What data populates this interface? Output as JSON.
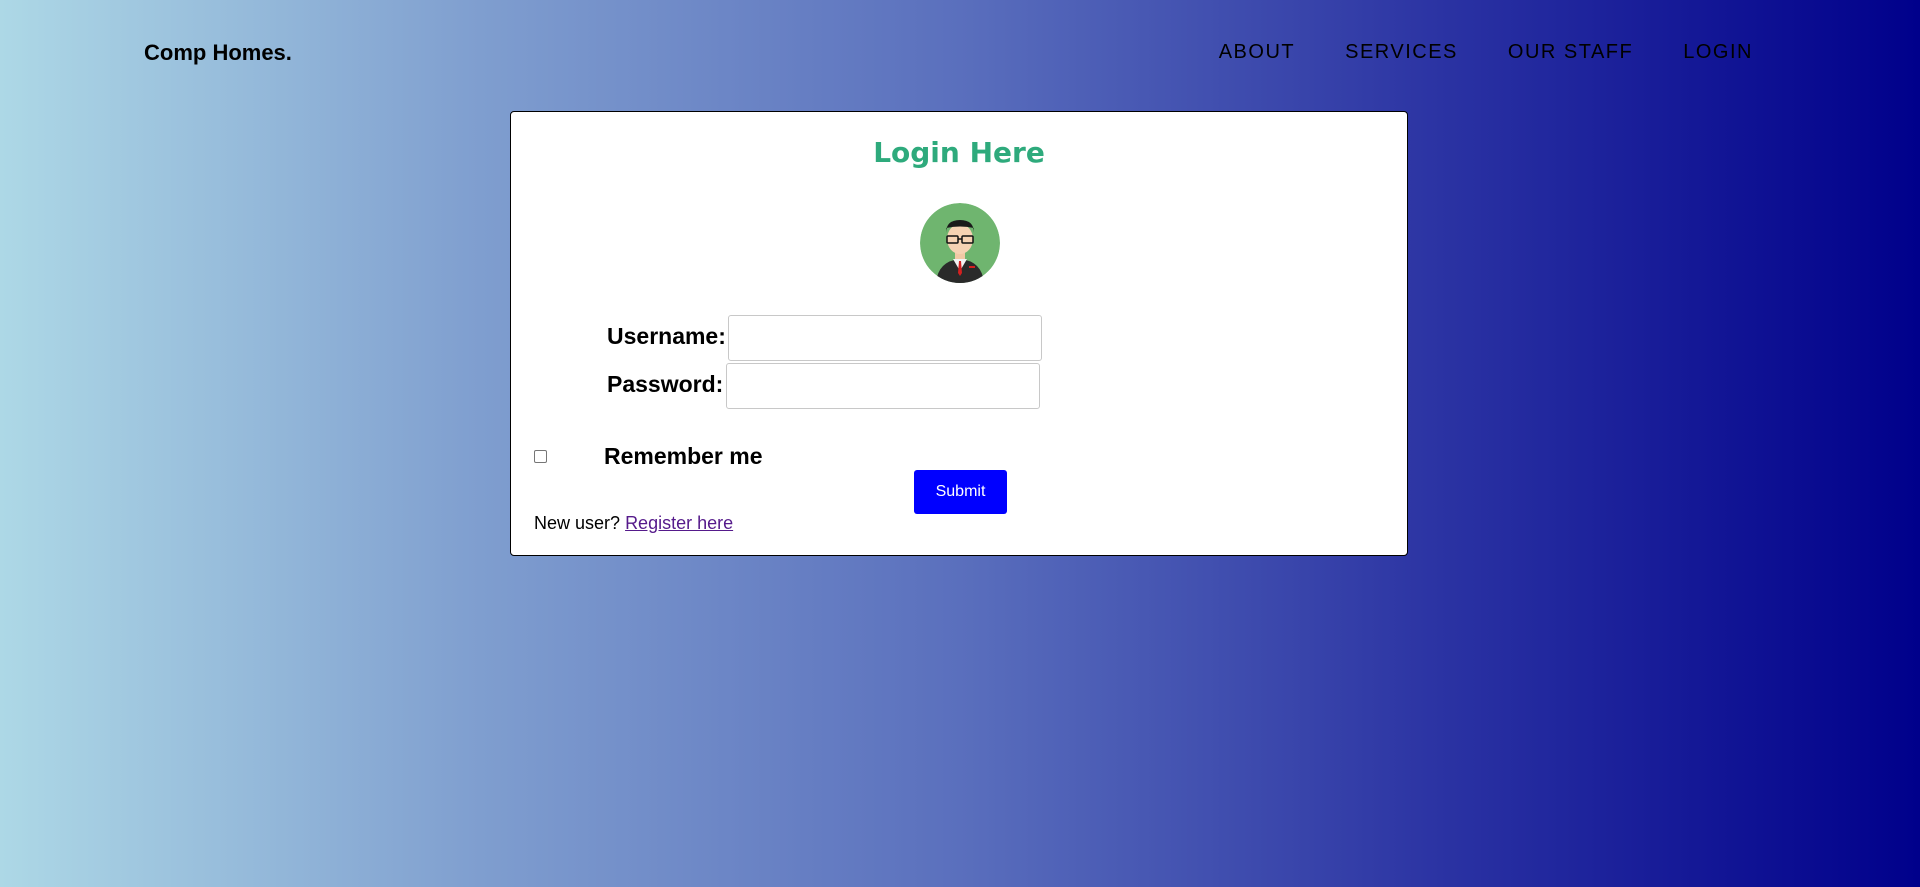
{
  "header": {
    "brand": "Comp Homes.",
    "nav": [
      "ABOUT",
      "SERVICES",
      "OUR STAFF",
      "LOGIN"
    ]
  },
  "login": {
    "title": "Login Here",
    "avatar_icon": "user-avatar-icon",
    "username_label": "Username:",
    "username_value": "",
    "password_label": "Password:",
    "password_value": "",
    "remember_label": "Remember me",
    "remember_checked": false,
    "submit_label": "Submit",
    "new_user_text": "New user?",
    "register_link": "Register here"
  },
  "colors": {
    "title": "#2eaa7c",
    "submit_bg": "#0000ff",
    "link": "#551a8b",
    "gradient_start": "#add8e6",
    "gradient_end": "#00008b"
  }
}
